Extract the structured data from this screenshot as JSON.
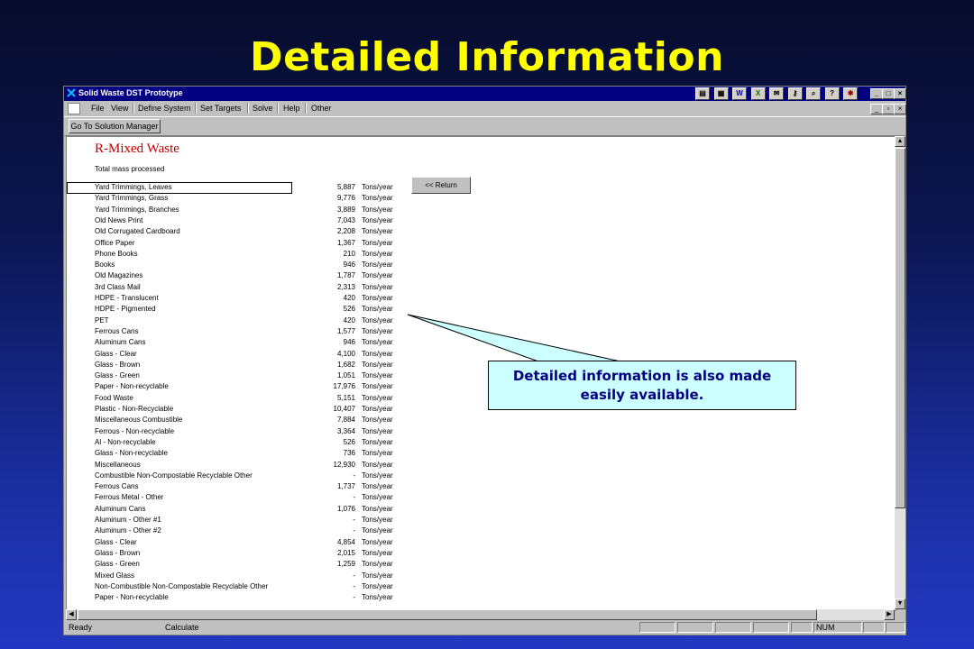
{
  "slide": {
    "title": "Detailed Information"
  },
  "window": {
    "title": "Solid Waste DST Prototype",
    "menu": [
      "File",
      "View",
      "Define System",
      "Set Targets",
      "Solve",
      "Help",
      "Other"
    ],
    "toolbar": {
      "solution_manager_label": "Go To Solution Manager"
    },
    "toolbar_icons": [
      "save-icon",
      "tile-icon",
      "word-icon",
      "excel-icon",
      "mail-icon",
      "key-icon",
      "search-icon",
      "help-icon",
      "bug-icon"
    ]
  },
  "report": {
    "title": "R-Mixed Waste",
    "subtitle": "Total mass processed",
    "return_label": "<< Return",
    "rows": [
      {
        "name": "Yard Trimmings, Leaves",
        "value": "5,887",
        "unit": "Tons/year"
      },
      {
        "name": "Yard Trimmings, Grass",
        "value": "9,776",
        "unit": "Tons/year"
      },
      {
        "name": "Yard Trimmings, Branches",
        "value": "3,889",
        "unit": "Tons/year"
      },
      {
        "name": "Old News Print",
        "value": "7,043",
        "unit": "Tons/year"
      },
      {
        "name": "Old Corrugated Cardboard",
        "value": "2,208",
        "unit": "Tons/year"
      },
      {
        "name": "Office Paper",
        "value": "1,367",
        "unit": "Tons/year"
      },
      {
        "name": "Phone Books",
        "value": "210",
        "unit": "Tons/year"
      },
      {
        "name": "Books",
        "value": "946",
        "unit": "Tons/year"
      },
      {
        "name": "Old Magazines",
        "value": "1,787",
        "unit": "Tons/year"
      },
      {
        "name": "3rd Class Mail",
        "value": "2,313",
        "unit": "Tons/year"
      },
      {
        "name": "HDPE - Translucent",
        "value": "420",
        "unit": "Tons/year"
      },
      {
        "name": "HDPE - Pigmented",
        "value": "526",
        "unit": "Tons/year"
      },
      {
        "name": "PET",
        "value": "420",
        "unit": "Tons/year"
      },
      {
        "name": "Ferrous Cans",
        "value": "1,577",
        "unit": "Tons/year"
      },
      {
        "name": "Aluminum Cans",
        "value": "946",
        "unit": "Tons/year"
      },
      {
        "name": "Glass - Clear",
        "value": "4,100",
        "unit": "Tons/year"
      },
      {
        "name": "Glass - Brown",
        "value": "1,682",
        "unit": "Tons/year"
      },
      {
        "name": "Glass - Green",
        "value": "1,051",
        "unit": "Tons/year"
      },
      {
        "name": "Paper - Non-recyclable",
        "value": "17,976",
        "unit": "Tons/year"
      },
      {
        "name": "Food Waste",
        "value": "5,151",
        "unit": "Tons/year"
      },
      {
        "name": "Plastic - Non-Recyclable",
        "value": "10,407",
        "unit": "Tons/year"
      },
      {
        "name": "Miscellaneous Combustible",
        "value": "7,884",
        "unit": "Tons/year"
      },
      {
        "name": "Ferrous - Non-recyclable",
        "value": "3,364",
        "unit": "Tons/year"
      },
      {
        "name": "Al - Non-recyclable",
        "value": "526",
        "unit": "Tons/year"
      },
      {
        "name": "Glass - Non-recyclable",
        "value": "736",
        "unit": "Tons/year"
      },
      {
        "name": "Miscellaneous",
        "value": "12,930",
        "unit": "Tons/year"
      },
      {
        "name": "Combustible Non-Compostable Recyclable Other",
        "value": "-",
        "unit": "Tons/year"
      },
      {
        "name": "Ferrous Cans",
        "value": "1,737",
        "unit": "Tons/year"
      },
      {
        "name": "Ferrous Metal - Other",
        "value": "-",
        "unit": "Tons/year"
      },
      {
        "name": "Aluminum Cans",
        "value": "1,076",
        "unit": "Tons/year"
      },
      {
        "name": "Aluminum - Other #1",
        "value": "-",
        "unit": "Tons/year"
      },
      {
        "name": "Aluminum - Other #2",
        "value": "-",
        "unit": "Tons/year"
      },
      {
        "name": "Glass - Clear",
        "value": "4,854",
        "unit": "Tons/year"
      },
      {
        "name": "Glass - Brown",
        "value": "2,015",
        "unit": "Tons/year"
      },
      {
        "name": "Glass - Green",
        "value": "1,259",
        "unit": "Tons/year"
      },
      {
        "name": "Mixed Glass",
        "value": "-",
        "unit": "Tons/year"
      },
      {
        "name": "Non-Combustible Non-Compostable Recyclable Other",
        "value": "-",
        "unit": "Tons/year"
      },
      {
        "name": "Paper - Non-recyclable",
        "value": "-",
        "unit": "Tons/year"
      }
    ]
  },
  "status": {
    "ready": "Ready",
    "mode": "Calculate",
    "num": "NUM"
  },
  "callout": {
    "line1": "Detailed information is also made",
    "line2": "easily available."
  }
}
